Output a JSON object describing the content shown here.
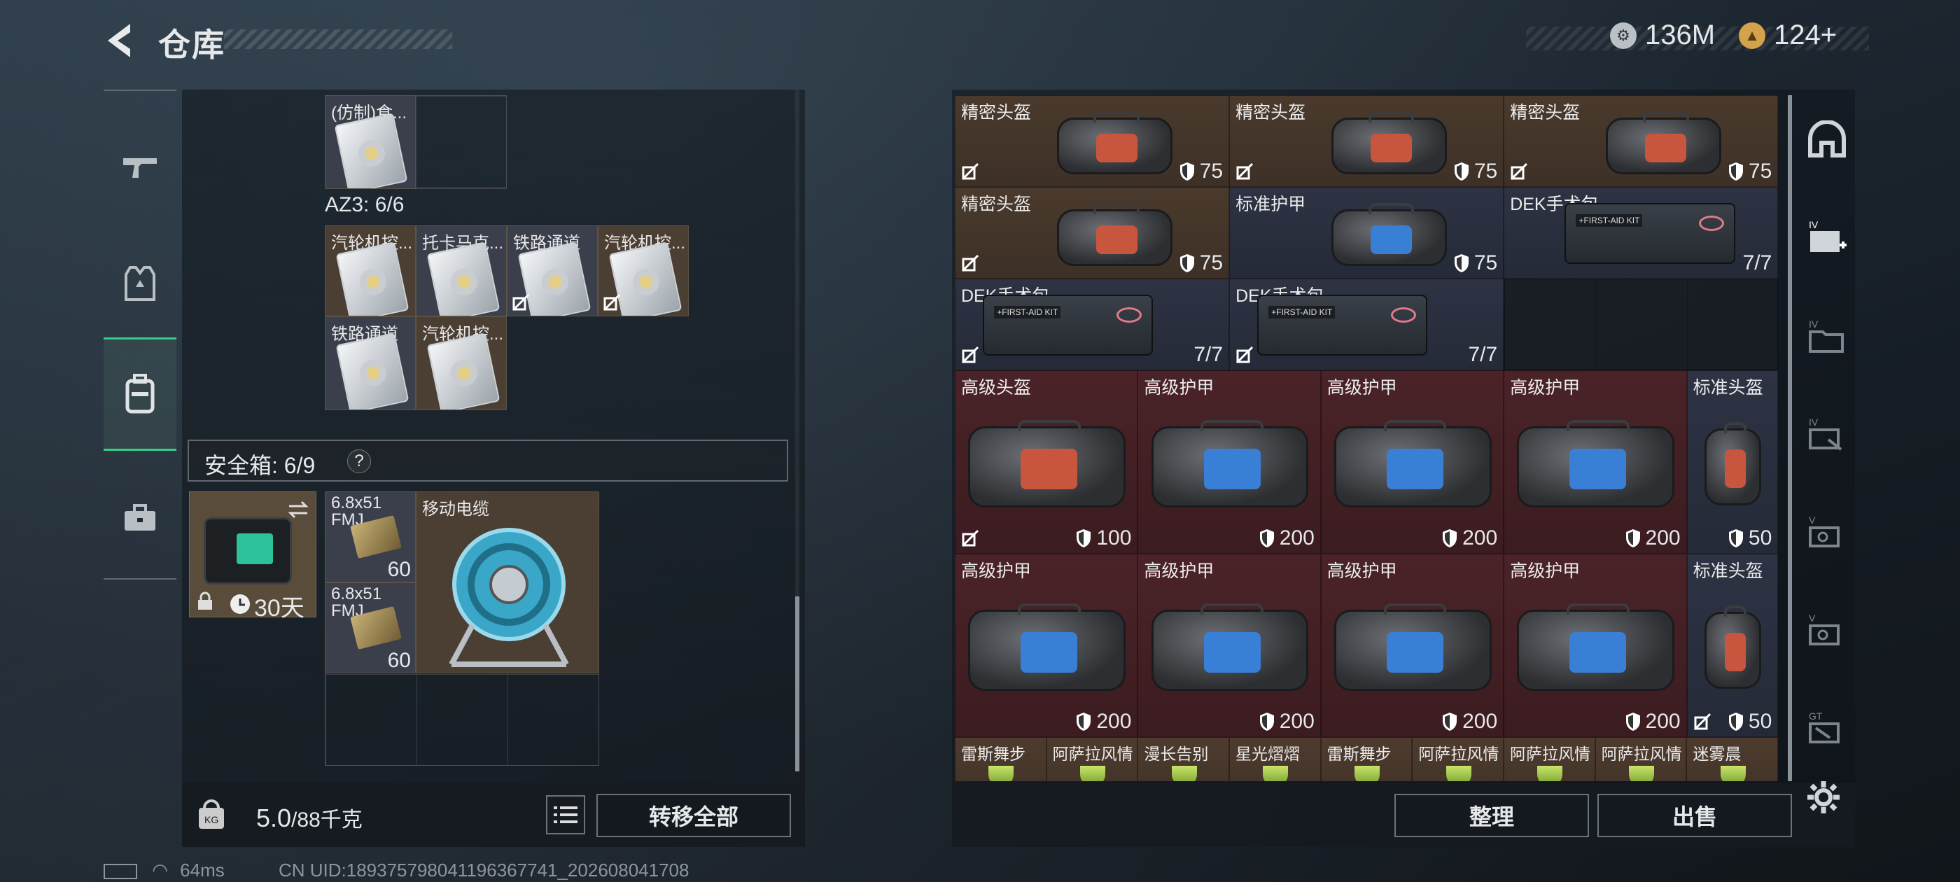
{
  "header": {
    "title": "仓库",
    "currency_1": "136M",
    "currency_2": "124+"
  },
  "left": {
    "top_item": "(仿制)食...",
    "az3_label": "AZ3: 6/6",
    "az3_items": [
      "汽轮机控...",
      "托卡马克...",
      "铁路通道",
      "汽轮机控...",
      "铁路通道",
      "汽轮机控..."
    ],
    "safe_label": "安全箱: 6/9",
    "safe_help": "?",
    "safe_days": "30天",
    "ammo_name": "6.8x51 FMJ",
    "ammo_count": "60",
    "cable_name": "移动电缆",
    "weight_value": "5.0",
    "weight_max": "/88千克",
    "transfer_all": "转移全部"
  },
  "right": {
    "items": [
      {
        "name": "精密头盔",
        "num": "75"
      },
      {
        "name": "精密头盔",
        "num": "75"
      },
      {
        "name": "精密头盔",
        "num": "75"
      },
      {
        "name": "精密头盔",
        "num": "75"
      },
      {
        "name": "标准护甲",
        "num": "75"
      },
      {
        "name": "DEK手术包",
        "num": "7/7"
      },
      {
        "name": "DEK手术包",
        "num": "7/7"
      },
      {
        "name": "DEK手术包",
        "num": "7/7"
      },
      {
        "name": "高级头盔",
        "num": "100"
      },
      {
        "name": "高级护甲",
        "num": "200"
      },
      {
        "name": "高级护甲",
        "num": "200"
      },
      {
        "name": "高级护甲",
        "num": "200"
      },
      {
        "name": "标准头盔",
        "num": "50"
      },
      {
        "name": "高级护甲",
        "num": "200"
      },
      {
        "name": "高级护甲",
        "num": "200"
      },
      {
        "name": "高级护甲",
        "num": "200"
      },
      {
        "name": "高级护甲",
        "num": "200"
      },
      {
        "name": "标准头盔",
        "num": "50"
      }
    ],
    "drinks": [
      "雷斯舞步",
      "阿萨拉风情",
      "漫长告别",
      "星光熠熠",
      "雷斯舞步",
      "阿萨拉风情",
      "阿萨拉风情",
      "阿萨拉风情",
      "迷雾晨"
    ],
    "sort": "整理",
    "sell": "出售"
  },
  "status": {
    "ping": "64ms",
    "uid": "CN UID:189375798041196367741_202608041708"
  },
  "colors": {
    "accent_green": "#2ed08a",
    "brown_cell": "#4a3a2d",
    "blue_cell": "#2e3344",
    "red_cell": "#4a2328"
  }
}
